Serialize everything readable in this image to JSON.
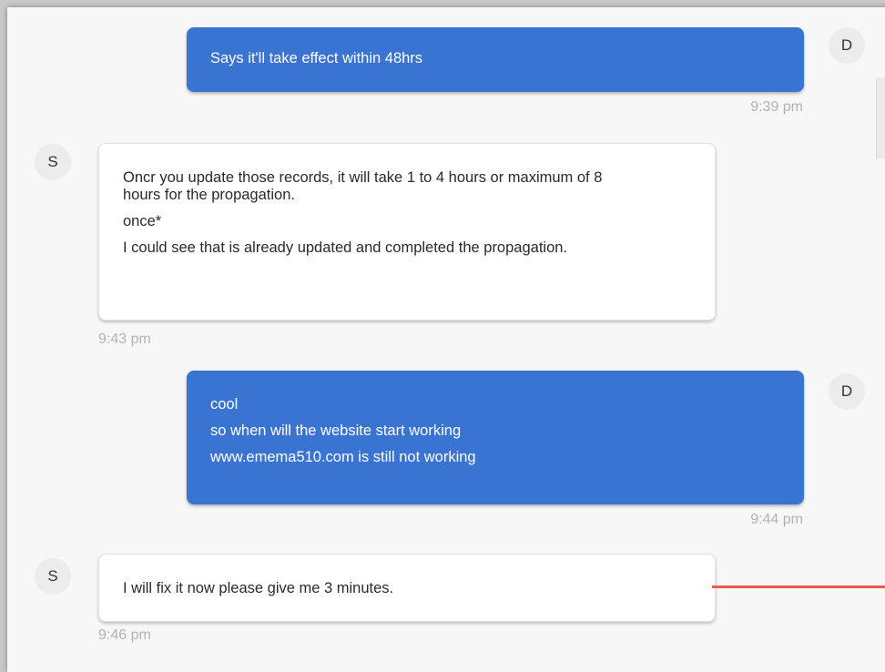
{
  "messages": [
    {
      "sender": "D",
      "direction": "outgoing",
      "lines": [
        "Says it'll take effect within 48hrs"
      ],
      "time": "9:39 pm"
    },
    {
      "sender": "S",
      "direction": "incoming",
      "lines": [
        "Oncr you update those records, it will take 1 to 4 hours or maximum of 8 hours for  the propagation.",
        "once*",
        "I could see  that is already updated and completed the propagation."
      ],
      "time": "9:43 pm"
    },
    {
      "sender": "D",
      "direction": "outgoing",
      "lines": [
        "cool",
        "so when will the website start working",
        "www.emema510.com is still not working"
      ],
      "time": "9:44 pm"
    },
    {
      "sender": "S",
      "direction": "incoming",
      "lines": [
        "I will fix it now please give me 3 minutes."
      ],
      "time": "9:46 pm"
    }
  ],
  "colors": {
    "outgoing_bubble": "#3a74d2",
    "incoming_bubble": "#ffffff",
    "timestamp": "#b3b3b3",
    "annotation_line": "#ea5b4f"
  }
}
